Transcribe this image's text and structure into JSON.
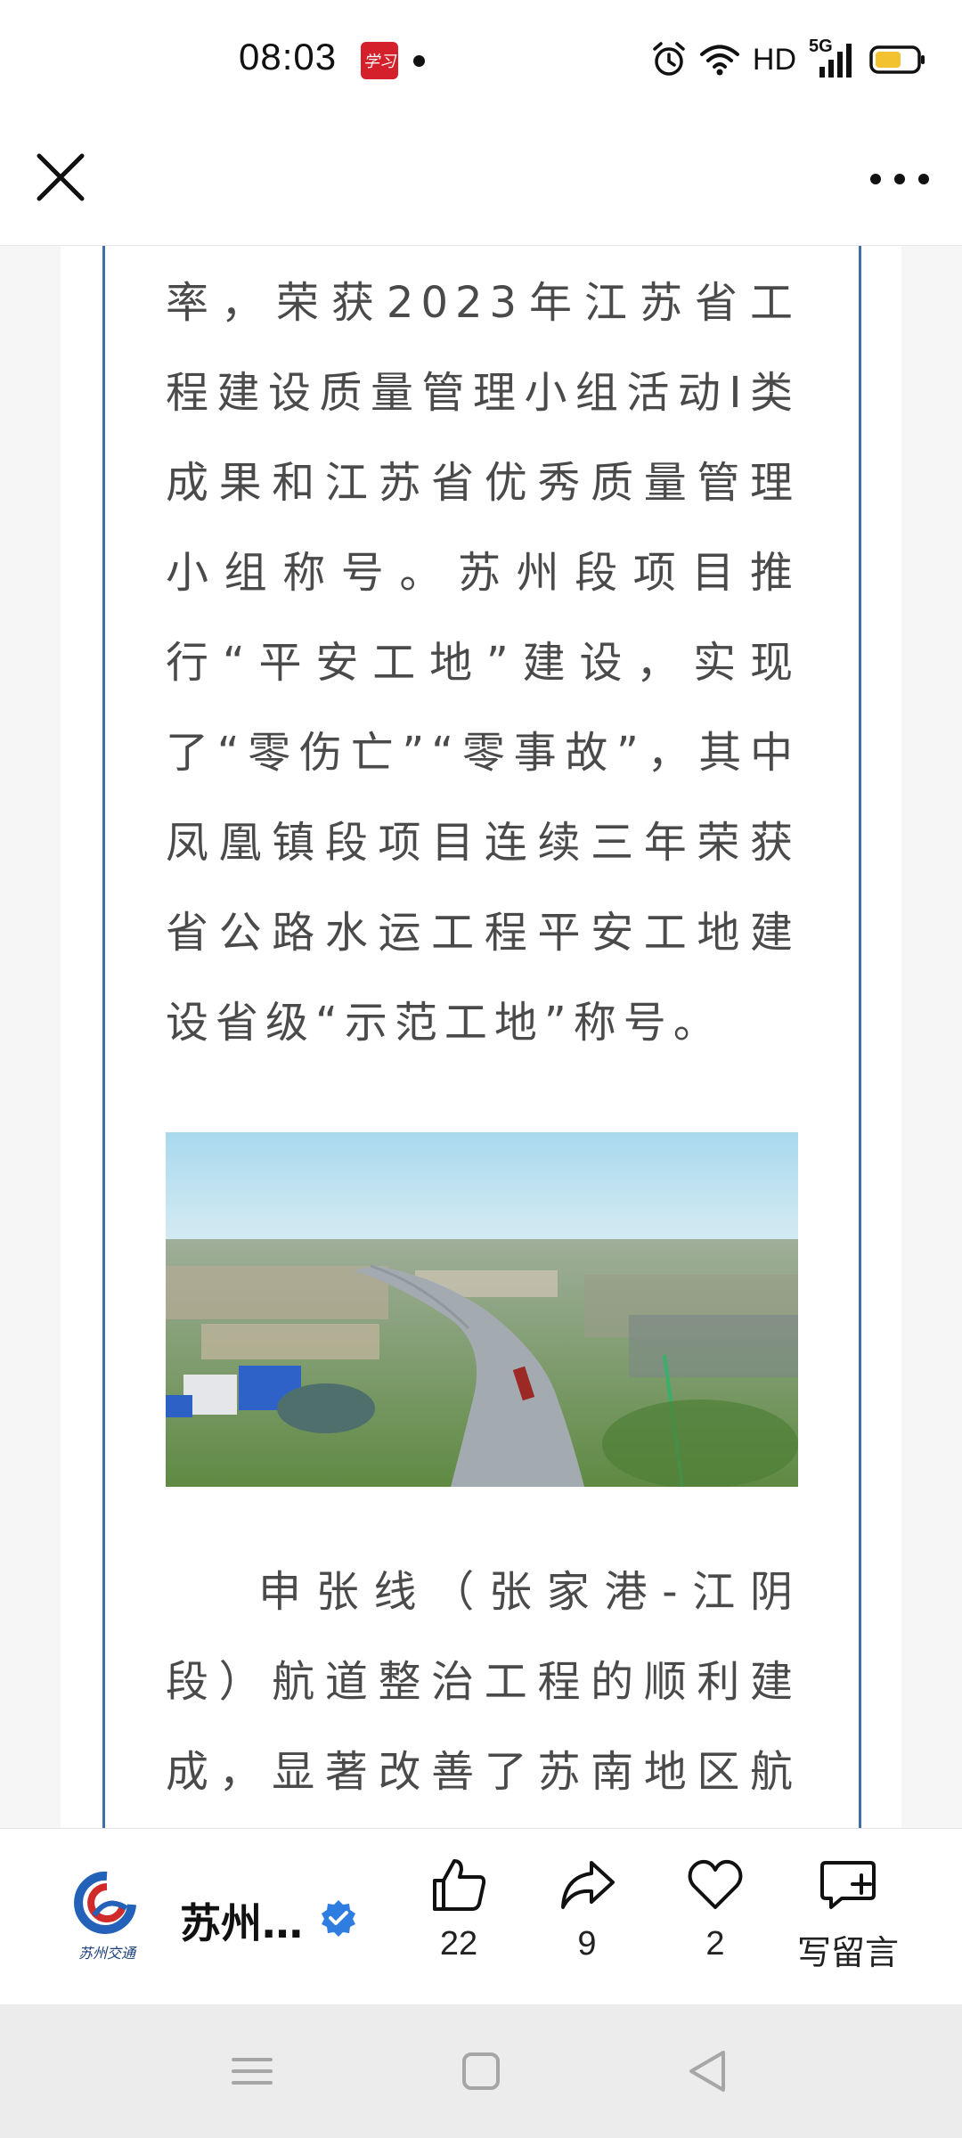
{
  "status_bar": {
    "time": "08:03",
    "app_badge": "学习",
    "network_label": "HD",
    "network_gen": "5G",
    "icons": [
      "alarm-icon",
      "wifi-icon",
      "signal-icon",
      "battery-icon"
    ]
  },
  "nav": {
    "close_icon": "close-icon",
    "more_icon": "more-icon"
  },
  "article": {
    "paragraph_1": "率，荣获2023年江苏省工程建设质量管理小组活动I类成果和江苏省优秀质量管理小组称号。苏州段项目推行“平安工地”建设，实现了“零伤亡”“零事故”，其中凤凰镇段项目连续三年荣获省公路水运工程平安工地建设省级“示范工地”称号。",
    "paragraph_2": "申张线（张家港-江阴段）航道整治工程的顺利建成，显著改善了苏南地区航道",
    "frame_color": "#3f6fa6",
    "text_color": "#4a4a4a"
  },
  "action_bar": {
    "account_name": "苏州…",
    "account_logo_text": "苏州交通",
    "like_count": "22",
    "share_count": "9",
    "favorite_count": "2",
    "comment_label": "写留言",
    "verified_color": "#2f7de1"
  },
  "system_nav": {
    "buttons": [
      "menu-icon",
      "home-icon",
      "back-icon"
    ]
  }
}
